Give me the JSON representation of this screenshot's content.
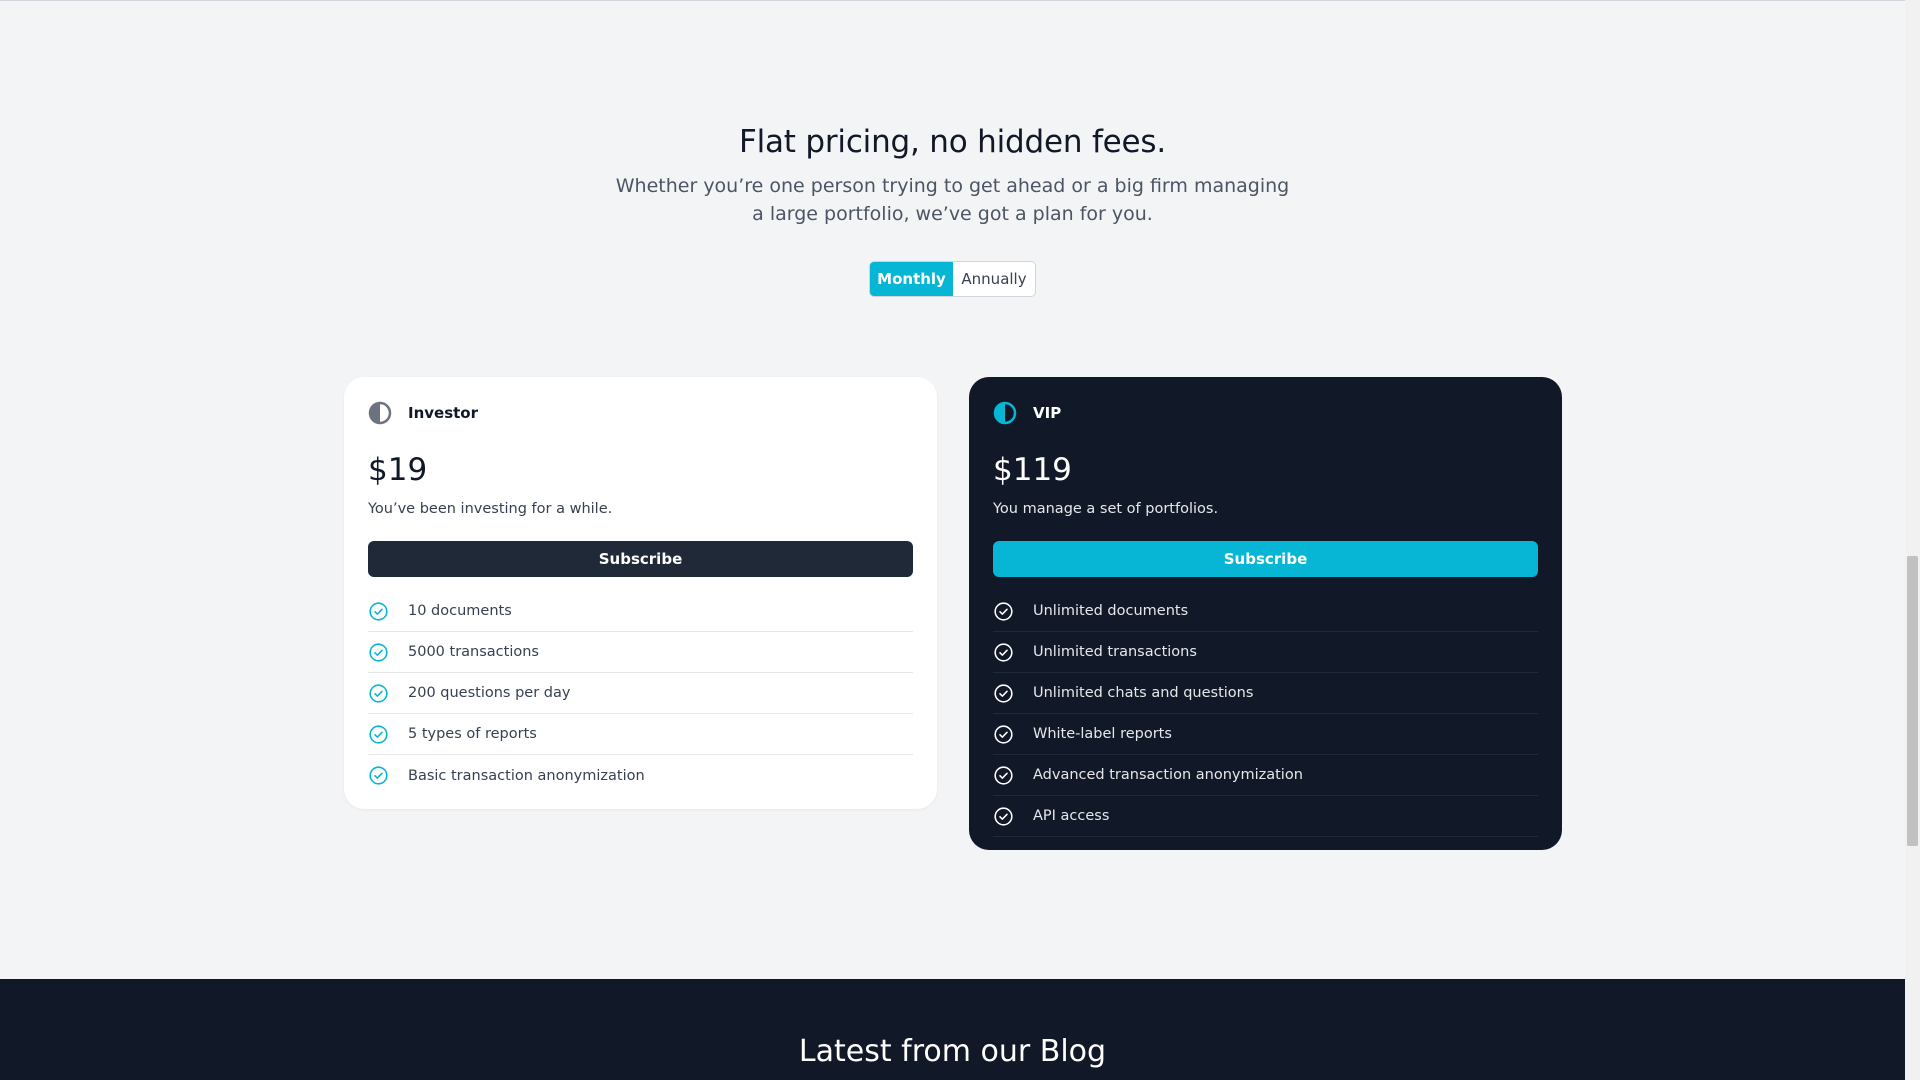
{
  "pricing": {
    "title": "Flat pricing, no hidden fees.",
    "subtitle": "Whether you’re one person trying to get ahead or a big firm managing a large portfolio, we’ve got a plan for you.",
    "toggle": {
      "monthly": "Monthly",
      "annually": "Annually",
      "selected": "Monthly"
    },
    "plans": [
      {
        "icon": "half-circle-icon",
        "name": "Investor",
        "price": "$19",
        "description": "You’ve been investing for a while.",
        "cta": "Subscribe",
        "features": [
          "10 documents",
          "5000 transactions",
          "200 questions per day",
          "5 types of reports",
          "Basic transaction anonymization"
        ]
      },
      {
        "icon": "half-circle-icon",
        "name": "VIP",
        "price": "$119",
        "description": "You manage a set of portfolios.",
        "cta": "Subscribe",
        "features": [
          "Unlimited documents",
          "Unlimited transactions",
          "Unlimited chats and questions",
          "White-label reports",
          "Advanced transaction anonymization",
          "API access"
        ]
      }
    ]
  },
  "blog": {
    "title": "Latest from our Blog"
  },
  "colors": {
    "accent": "#06b6d4",
    "dark": "#111827",
    "background": "#f3f4f6"
  }
}
